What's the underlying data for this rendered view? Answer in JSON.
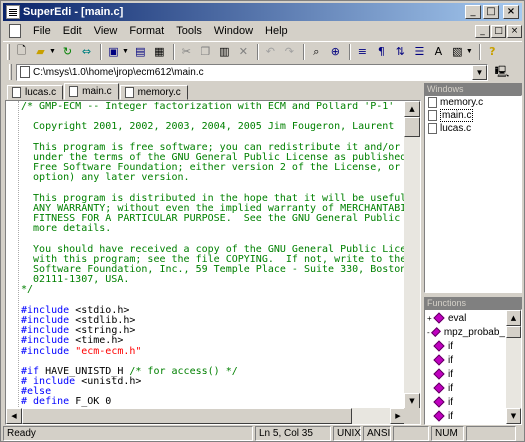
{
  "window": {
    "title": "SuperEdi - [main.c]"
  },
  "title_buttons": {
    "minimize": "_",
    "maximize": "□",
    "close": "×"
  },
  "menu": [
    "File",
    "Edit",
    "View",
    "Format",
    "Tools",
    "Window",
    "Help"
  ],
  "path": {
    "value": "C:\\msys\\1.0\\home\\jrop\\ecm612\\main.c"
  },
  "tabs": [
    {
      "label": "lucas.c",
      "active": false
    },
    {
      "label": "main.c",
      "active": true
    },
    {
      "label": "memory.c",
      "active": false
    }
  ],
  "code_lines": [
    [
      [
        "c",
        "/* GMP-ECM -- Integer factorization with ECM and Pollard 'P-1'"
      ]
    ],
    [
      [
        "c",
        ""
      ]
    ],
    [
      [
        "c",
        "  Copyright 2001, 2002, 2003, 2004, 2005 Jim Fougeron, Laurent"
      ]
    ],
    [
      [
        "c",
        ""
      ]
    ],
    [
      [
        "c",
        "  This program is free software; you can redistribute it and/or"
      ]
    ],
    [
      [
        "c",
        "  under the terms of the GNU General Public License as published"
      ]
    ],
    [
      [
        "c",
        "  Free Software Foundation; either version 2 of the License, or"
      ]
    ],
    [
      [
        "c",
        "  option) any later version."
      ]
    ],
    [
      [
        "c",
        ""
      ]
    ],
    [
      [
        "c",
        "  This program is distributed in the hope that it will be useful"
      ]
    ],
    [
      [
        "c",
        "  ANY WARRANTY; without even the implied warranty of MERCHANTABI"
      ]
    ],
    [
      [
        "c",
        "  FITNESS FOR A PARTICULAR PURPOSE.  See the GNU General Public"
      ]
    ],
    [
      [
        "c",
        "  more details."
      ]
    ],
    [
      [
        "c",
        ""
      ]
    ],
    [
      [
        "c",
        "  You should have received a copy of the GNU General Public Lice"
      ]
    ],
    [
      [
        "c",
        "  with this program; see the file COPYING.  If not, write to the"
      ]
    ],
    [
      [
        "c",
        "  Software Foundation, Inc., 59 Temple Place - Suite 330, Boston"
      ]
    ],
    [
      [
        "c",
        "  02111-1307, USA."
      ]
    ],
    [
      [
        "c",
        "*/"
      ]
    ],
    [
      [
        "t",
        ""
      ]
    ],
    [
      [
        "k",
        "#include"
      ],
      [
        "t",
        " <stdio.h>"
      ]
    ],
    [
      [
        "k",
        "#include"
      ],
      [
        "t",
        " <stdlib.h>"
      ]
    ],
    [
      [
        "k",
        "#include"
      ],
      [
        "t",
        " <string.h>"
      ]
    ],
    [
      [
        "k",
        "#include"
      ],
      [
        "t",
        " <time.h>"
      ]
    ],
    [
      [
        "k",
        "#include"
      ],
      [
        "t",
        " "
      ],
      [
        "s",
        "\"ecm-ecm.h\""
      ]
    ],
    [
      [
        "t",
        ""
      ]
    ],
    [
      [
        "k",
        "#if"
      ],
      [
        "t",
        " HAVE_UNISTD_H "
      ],
      [
        "c",
        "/* for access() */"
      ]
    ],
    [
      [
        "k",
        "# include"
      ],
      [
        "t",
        " <unistd.h>"
      ]
    ],
    [
      [
        "k",
        "#else"
      ]
    ],
    [
      [
        "k",
        "# define"
      ],
      [
        "t",
        " F_OK 0"
      ]
    ]
  ],
  "windows_panel": {
    "title": "Windows",
    "items": [
      {
        "label": "memory.c",
        "selected": false
      },
      {
        "label": "main.c",
        "selected": true
      },
      {
        "label": "lucas.c",
        "selected": false
      }
    ]
  },
  "functions_panel": {
    "title": "Functions",
    "items": [
      {
        "label": "eval",
        "expander": "+"
      },
      {
        "label": "mpz_probab_",
        "expander": "-"
      },
      {
        "label": "if",
        "expander": ""
      },
      {
        "label": "if",
        "expander": ""
      },
      {
        "label": "if",
        "expander": ""
      },
      {
        "label": "if",
        "expander": ""
      },
      {
        "label": "if",
        "expander": ""
      },
      {
        "label": "if",
        "expander": ""
      },
      {
        "label": "if",
        "expander": ""
      }
    ]
  },
  "status": {
    "message": "Ready",
    "position": "Ln 5, Col 35",
    "line_ending": "UNIX",
    "encoding": "ANSI",
    "numlock": "NUM"
  },
  "colors": {
    "comment": "#008000",
    "keyword": "#0000ff",
    "string": "#ff0000",
    "titlebar_start": "#0a246a"
  }
}
